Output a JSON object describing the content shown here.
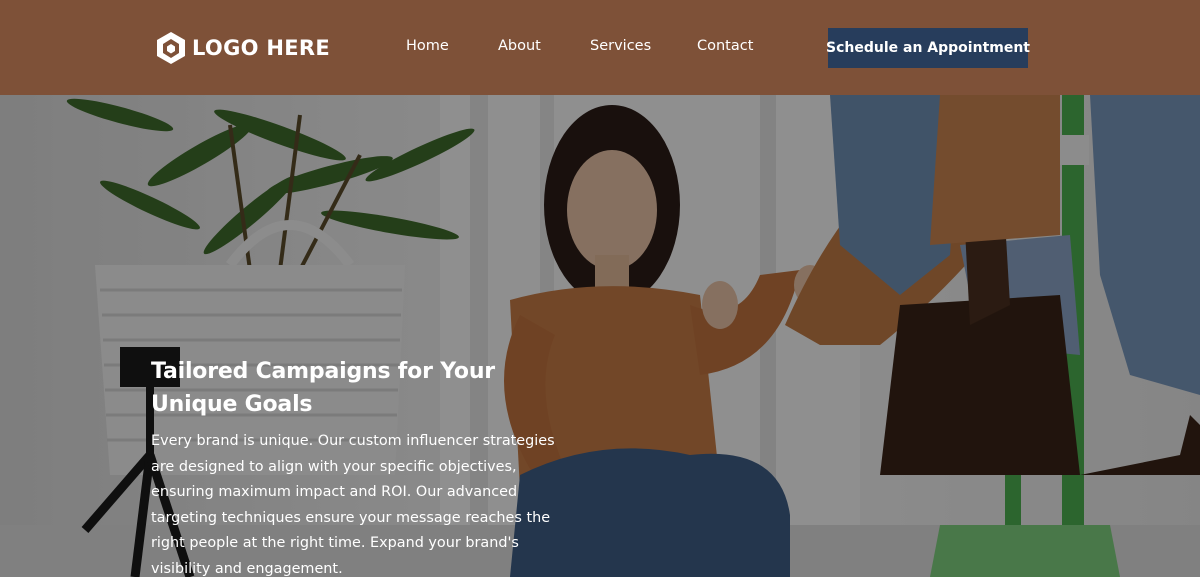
{
  "header": {
    "logo_text": "LOGO HERE",
    "nav": [
      {
        "label": "Home"
      },
      {
        "label": "About"
      },
      {
        "label": "Services"
      },
      {
        "label": "Contact"
      }
    ],
    "cta_label": "Schedule an Appointment",
    "colors": {
      "background": "#7e5138",
      "cta": "#273d5c"
    }
  },
  "hero": {
    "title_line1": "Tailored Campaigns for Your",
    "title_line2": "Unique Goals",
    "body": "Every brand is unique. Our custom influencer strategies are designed to align with your specific objectives, ensuring maximum impact and ROI. Our advanced targeting techniques ensure your message reaches the right people at the right time. Expand your brand's visibility and engagement.",
    "image": "woman-sitting-with-clothes-rack-photo"
  }
}
